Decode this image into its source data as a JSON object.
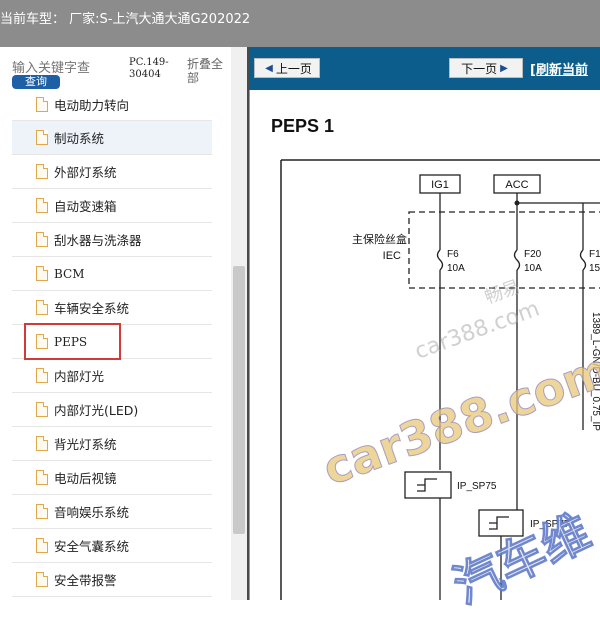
{
  "header": {
    "title": "当前车型：  厂家:S-上汽大通大通G202022"
  },
  "sidebar": {
    "search_placeholder": "输入关键字查",
    "search_button": "查询",
    "doc_code": "PC.149-30404",
    "collapse_all": "折叠全部",
    "items": [
      {
        "label": "电动助力转向"
      },
      {
        "label": "制动系统"
      },
      {
        "label": "外部灯系统"
      },
      {
        "label": "自动变速箱"
      },
      {
        "label": "刮水器与洗涤器"
      },
      {
        "label": "BCM"
      },
      {
        "label": "车辆安全系统"
      },
      {
        "label": "PEPS"
      },
      {
        "label": "内部灯光"
      },
      {
        "label": "内部灯光(LED)"
      },
      {
        "label": "背光灯系统"
      },
      {
        "label": "电动后视镜"
      },
      {
        "label": "音响娱乐系统"
      },
      {
        "label": "安全气囊系统"
      },
      {
        "label": "安全带报警"
      }
    ]
  },
  "toolbar": {
    "prev_label": "上一页",
    "next_label": "下一页",
    "refresh_label": "[刷新当前"
  },
  "diagram": {
    "title": "PEPS 1",
    "ig1": "IG1",
    "acc": "ACC",
    "fusebox_label": "主保险丝盒",
    "fusebox_sub": "IEC",
    "fuse1_name": "F6",
    "fuse1_rating": "10A",
    "fuse2_name": "F20",
    "fuse2_rating": "10A",
    "fuse3_name": "F1",
    "fuse3_rating": "15",
    "wire_label": "1389_L-GN/D-BU_0.75_IP",
    "splice1": "IP_SP75",
    "splice2": "IP_SP77"
  },
  "watermark": {
    "line1": "畅易",
    "line2": "car388.com",
    "line3": "car388.com",
    "line4": "汽车维"
  },
  "colors": {
    "header_bg": "#8c8c8c",
    "toolbar_bg": "#0d5d8c",
    "highlight": "#d23a3a",
    "search_button_bg": "#1f5fa6"
  }
}
